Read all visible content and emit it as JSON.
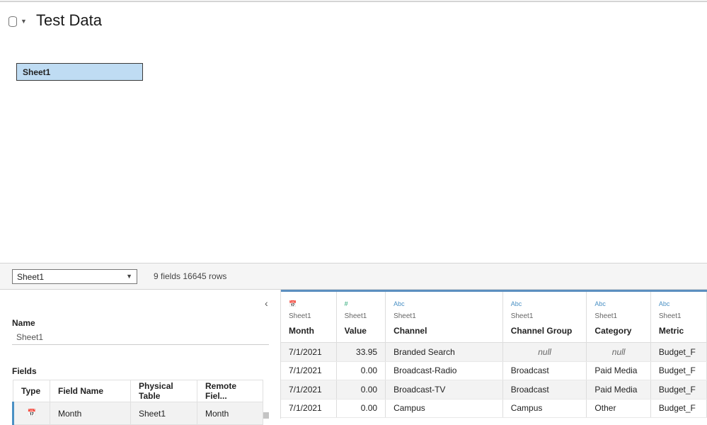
{
  "header": {
    "title": "Test Data"
  },
  "canvas": {
    "table_label": "Sheet1"
  },
  "toolbar": {
    "table_select": "Sheet1",
    "counts": "9 fields 16645 rows"
  },
  "left": {
    "name_label": "Name",
    "name_value": "Sheet1",
    "fields_label": "Fields",
    "columns": [
      "Type",
      "Field Name",
      "Physical Table",
      "Remote Fiel..."
    ],
    "rows": [
      {
        "field": "Month",
        "table": "Sheet1",
        "remote": "Month"
      }
    ]
  },
  "grid": {
    "columns": [
      {
        "type": "date",
        "source": "Sheet1",
        "name": "Month",
        "icon": "📅"
      },
      {
        "type": "number",
        "source": "Sheet1",
        "name": "Value",
        "icon": "#"
      },
      {
        "type": "string",
        "source": "Sheet1",
        "name": "Channel",
        "icon": "Abc"
      },
      {
        "type": "string",
        "source": "Sheet1",
        "name": "Channel Group",
        "icon": "Abc"
      },
      {
        "type": "string",
        "source": "Sheet1",
        "name": "Category",
        "icon": "Abc"
      },
      {
        "type": "string",
        "source": "Sheet1",
        "name": "Metric",
        "icon": "Abc"
      }
    ],
    "rows": [
      [
        "7/1/2021",
        "33.95",
        "Branded Search",
        "null",
        "null",
        "Budget_F"
      ],
      [
        "7/1/2021",
        "0.00",
        "Broadcast-Radio",
        "Broadcast",
        "Paid Media",
        "Budget_F"
      ],
      [
        "7/1/2021",
        "0.00",
        "Broadcast-TV",
        "Broadcast",
        "Paid Media",
        "Budget_F"
      ],
      [
        "7/1/2021",
        "0.00",
        "Campus",
        "Campus",
        "Other",
        "Budget_F"
      ]
    ]
  },
  "colors": {
    "accent": "#5b8fc0",
    "selected_table": "#bfdcf3"
  }
}
